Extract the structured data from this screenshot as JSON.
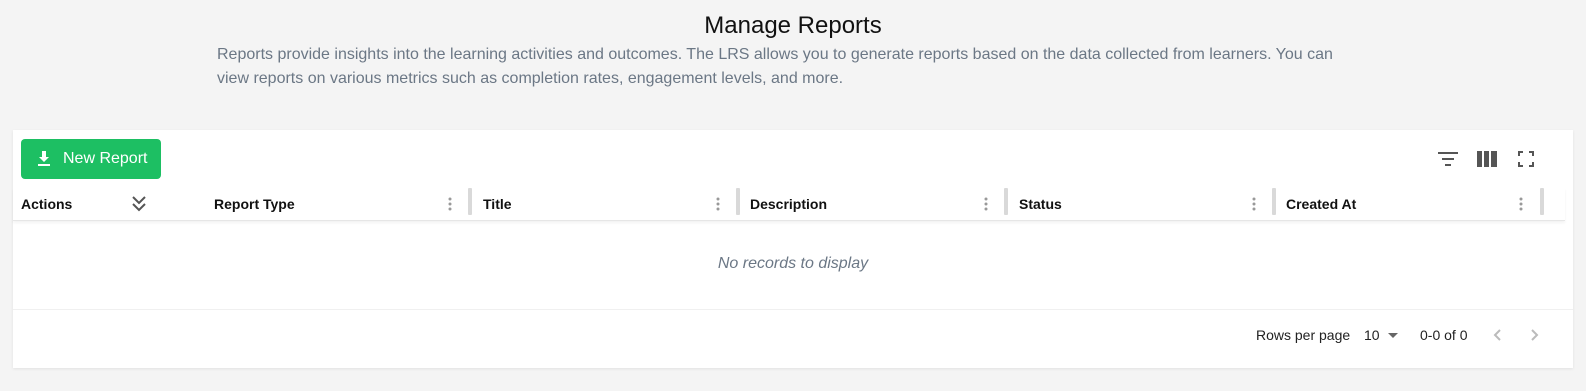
{
  "page": {
    "title": "Manage Reports",
    "description": "Reports provide insights into the learning activities and outcomes. The LRS allows you to generate reports based on the data collected from learners. You can view reports on various metrics such as completion rates, engagement levels, and more."
  },
  "toolbar": {
    "new_report_label": "New Report",
    "new_report_icon": "download-icon",
    "accent_color": "#1dbf63",
    "icons": [
      "filter-icon",
      "columns-icon",
      "fullscreen-icon"
    ]
  },
  "table": {
    "columns": [
      {
        "label": "Actions"
      },
      {
        "label": "Report Type"
      },
      {
        "label": "Title"
      },
      {
        "label": "Description"
      },
      {
        "label": "Status"
      },
      {
        "label": "Created At"
      }
    ],
    "empty_text": "No records to display"
  },
  "pagination": {
    "rows_per_page_label": "Rows per page",
    "rows_per_page_value": "10",
    "range_text": "0-0 of 0"
  }
}
